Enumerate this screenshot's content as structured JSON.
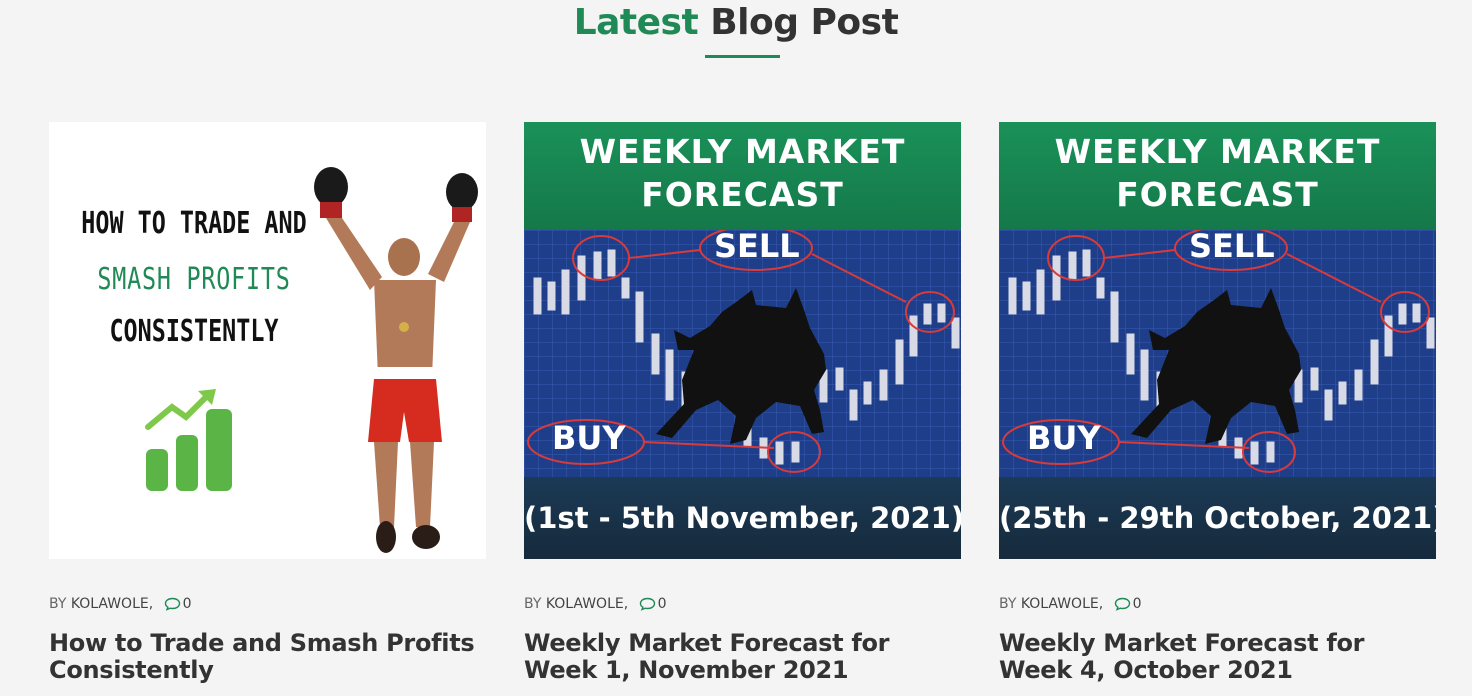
{
  "section": {
    "title_accent": "Latest",
    "title_rest": "Blog Post"
  },
  "colors": {
    "accent": "#1f8a55",
    "text": "#333333"
  },
  "posts": [
    {
      "image": {
        "line1": "HOW TO TRADE AND",
        "line2": "SMASH PROFITS",
        "line3": "CONSISTENTLY"
      },
      "by": "BY",
      "author": "KOLAWOLE,",
      "comments": "0",
      "comment_icon": "comment-icon",
      "title": "How to Trade and Smash Profits Consistently"
    },
    {
      "image": {
        "header1": "WEEKLY MARKET",
        "header2": "FORECAST",
        "sell": "SELL",
        "buy": "BUY",
        "date": "(1st - 5th November, 2021)"
      },
      "by": "BY",
      "author": "KOLAWOLE,",
      "comments": "0",
      "comment_icon": "comment-icon",
      "title": "Weekly Market Forecast for Week 1, November 2021"
    },
    {
      "image": {
        "header1": "WEEKLY MARKET",
        "header2": "FORECAST",
        "sell": "SELL",
        "buy": "BUY",
        "date": "(25th - 29th October, 2021)"
      },
      "by": "BY",
      "author": "KOLAWOLE,",
      "comments": "0",
      "comment_icon": "comment-icon",
      "title": "Weekly Market Forecast for Week 4, October 2021"
    }
  ]
}
